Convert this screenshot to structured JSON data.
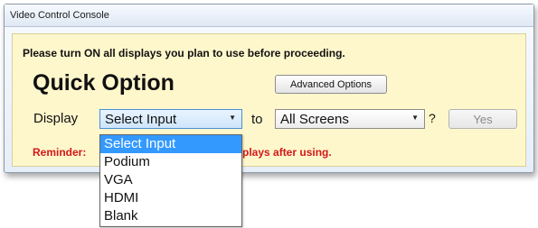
{
  "window": {
    "title": "Video Control Console"
  },
  "panel": {
    "notice": "Please turn ON all displays you plan to use before proceeding.",
    "heading": "Quick Option",
    "advanced_button": "Advanced Options",
    "display_label": "Display",
    "to_label": "to",
    "question_mark": "?",
    "yes_button": "Yes",
    "reminder_visible_start": "Reminder:",
    "reminder_visible_end": "plays after using."
  },
  "input_select": {
    "selected": "Select Input",
    "options": [
      "Select Input",
      "Podium",
      "VGA",
      "HDMI",
      "Blank"
    ],
    "highlighted_index": 0
  },
  "screen_select": {
    "selected": "All Screens"
  },
  "colors": {
    "panel_background": "#fff7cc",
    "reminder_text": "#d21818",
    "highlight": "#3399ff"
  },
  "icons": {
    "dropdown_arrow": "chevron-down-icon"
  }
}
